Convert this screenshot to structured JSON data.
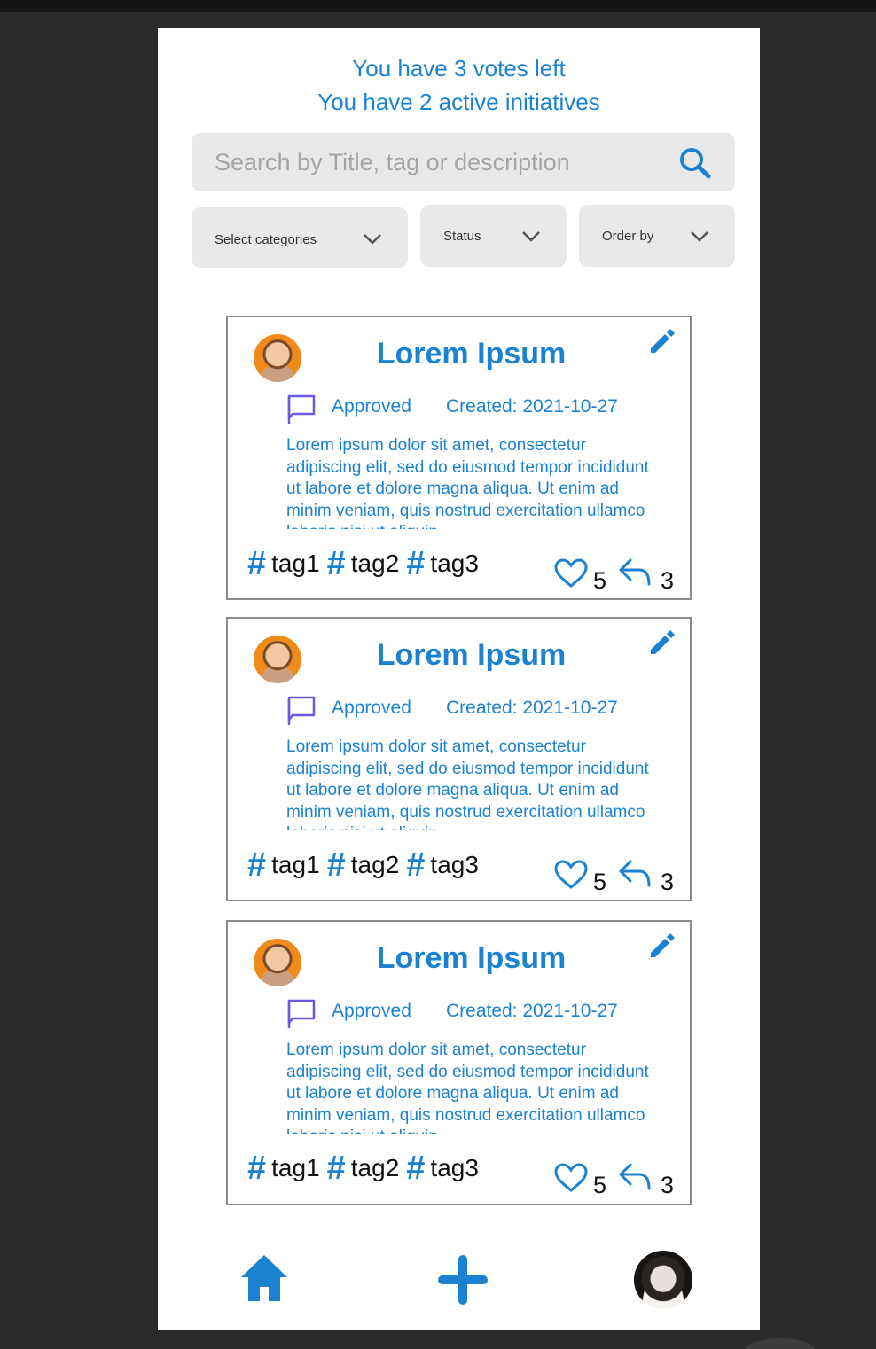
{
  "stats": {
    "votes_left": "You have 3 votes left",
    "active_initiatives": "You have 2 active initiatives"
  },
  "search": {
    "placeholder": "Search by Title, tag or description",
    "value": "",
    "icon": "search-icon"
  },
  "filters": [
    {
      "label": "Select categories",
      "icon": "chevron-down-icon"
    },
    {
      "label": "Status",
      "icon": "chevron-down-icon"
    },
    {
      "label": "Order by",
      "icon": "chevron-down-icon"
    }
  ],
  "cards": [
    {
      "title": "Lorem Ipsum",
      "status": "Approved",
      "created": "Created: 2021-10-27",
      "description": "Lorem ipsum dolor sit amet, consectetur adipiscing elit, sed do eiusmod tempor incididunt ut labore et dolore magna aliqua. Ut enim ad minim veniam, quis nostrud exercitation ullamco laboris nisi ut aliquip",
      "tags": [
        "tag1",
        "tag2",
        "tag3"
      ],
      "likes": "5",
      "replies": "3"
    },
    {
      "title": "Lorem Ipsum",
      "status": "Approved",
      "created": "Created: 2021-10-27",
      "description": "Lorem ipsum dolor sit amet, consectetur adipiscing elit, sed do eiusmod tempor incididunt ut labore et dolore magna aliqua. Ut enim ad minim veniam, quis nostrud exercitation ullamco laboris nisi ut aliquip",
      "tags": [
        "tag1",
        "tag2",
        "tag3"
      ],
      "likes": "5",
      "replies": "3"
    },
    {
      "title": "Lorem Ipsum",
      "status": "Approved",
      "created": "Created: 2021-10-27",
      "description": "Lorem ipsum dolor sit amet, consectetur adipiscing elit, sed do eiusmod tempor incididunt ut labore et dolore magna aliqua. Ut enim ad minim veniam, quis nostrud exercitation ullamco laboris nisi ut aliquip",
      "tags": [
        "tag1",
        "tag2",
        "tag3"
      ],
      "likes": "5",
      "replies": "3"
    }
  ],
  "bottom_nav": {
    "home_icon": "home-icon",
    "add_icon": "plus-icon",
    "profile": "profile-avatar"
  },
  "colors": {
    "accent": "#1b82d2",
    "background": "#2b2b2b",
    "panel": "#ffffff",
    "input_bg": "#e9e9e9",
    "flag": "#6a5ae0"
  }
}
